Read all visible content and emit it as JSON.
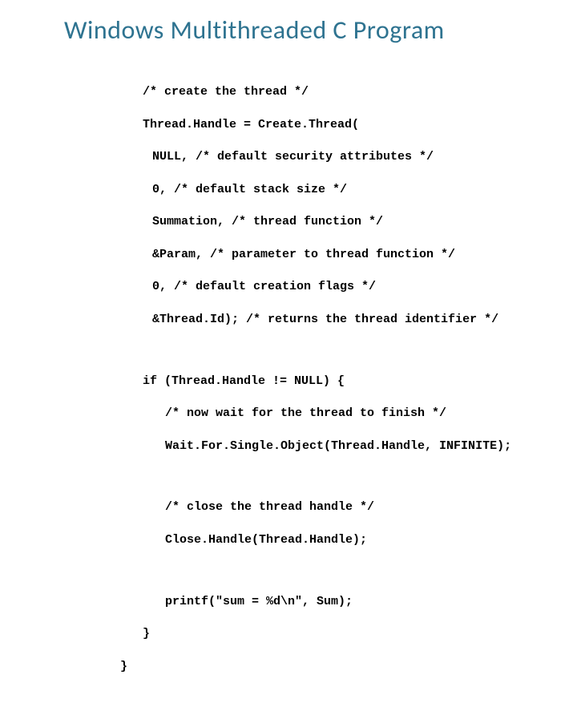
{
  "title": "Windows  Multithreaded C Program",
  "code": {
    "l01": "/* create the thread */",
    "l02": "Thread.Handle = Create.Thread(",
    "l03": "NULL, /* default security attributes */",
    "l04": "0, /* default stack size */",
    "l05": "Summation, /* thread function */",
    "l06": "&Param, /* parameter to thread function */",
    "l07": "0, /* default creation flags */",
    "l08": "&Thread.Id); /* returns the thread identifier */",
    "l09": "if (Thread.Handle != NULL) {",
    "l10": "/* now wait for the thread to finish */",
    "l11": "Wait.For.Single.Object(Thread.Handle, INFINITE);",
    "l12": "/* close the thread handle */",
    "l13": "Close.Handle(Thread.Handle);",
    "l14": "printf(\"sum = %d\\n\", Sum);",
    "l15": "}",
    "l16": "}"
  }
}
